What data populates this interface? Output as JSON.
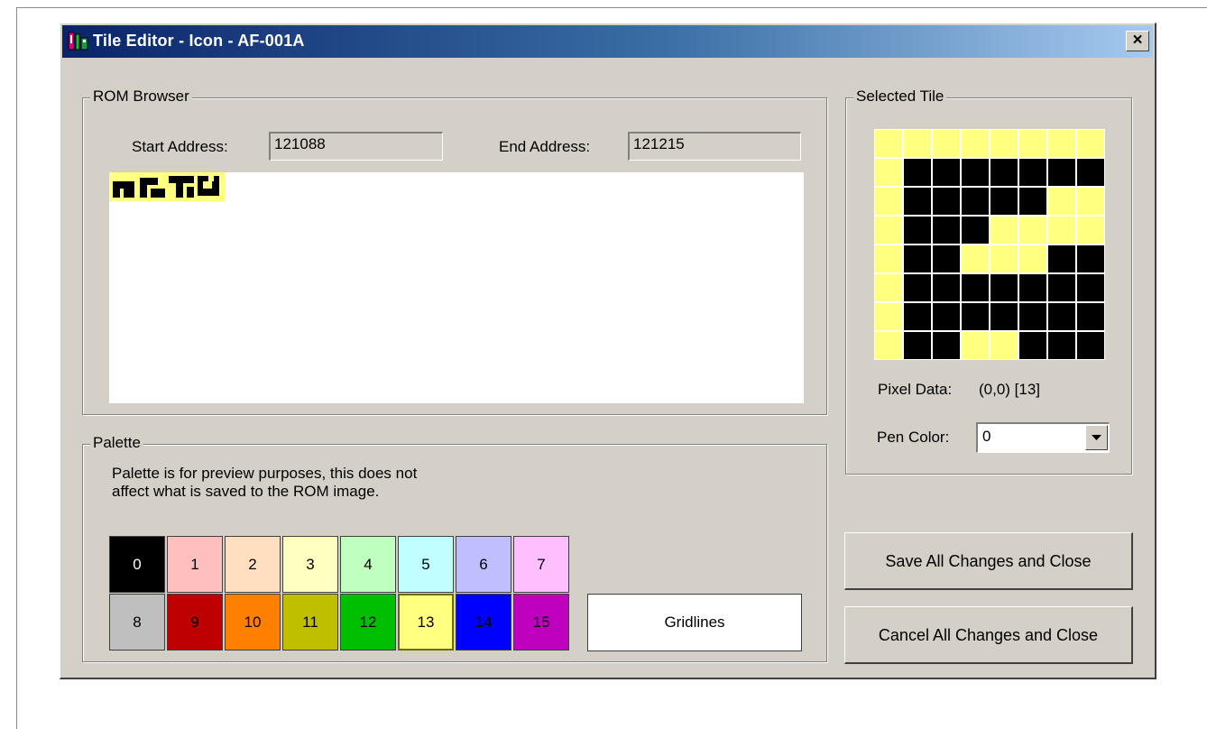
{
  "window": {
    "title": "Tile Editor - Icon - AF-001A",
    "close_label": "×"
  },
  "rom_browser": {
    "legend": "ROM Browser",
    "start_label": "Start Address:",
    "start_value": "121088",
    "end_label": "End Address:",
    "end_value": "121215"
  },
  "palette": {
    "legend": "Palette",
    "note_line1": "Palette is for preview purposes, this does not",
    "note_line2": "affect what is saved to the ROM image.",
    "selected_index": 13,
    "colors": [
      {
        "label": "0",
        "bg": "#000000",
        "fg": "#ffffff"
      },
      {
        "label": "1",
        "bg": "#ffbfbf",
        "fg": "#000000"
      },
      {
        "label": "2",
        "bg": "#ffdfbf",
        "fg": "#000000"
      },
      {
        "label": "3",
        "bg": "#ffffbf",
        "fg": "#000000"
      },
      {
        "label": "4",
        "bg": "#bfffbf",
        "fg": "#000000"
      },
      {
        "label": "5",
        "bg": "#bfffff",
        "fg": "#000000"
      },
      {
        "label": "6",
        "bg": "#bfbfff",
        "fg": "#000000"
      },
      {
        "label": "7",
        "bg": "#ffbfff",
        "fg": "#000000"
      },
      {
        "label": "8",
        "bg": "#bfbfbf",
        "fg": "#000000"
      },
      {
        "label": "9",
        "bg": "#bf0000",
        "fg": "#000000"
      },
      {
        "label": "10",
        "bg": "#ff8000",
        "fg": "#000000"
      },
      {
        "label": "11",
        "bg": "#bfbf00",
        "fg": "#000000"
      },
      {
        "label": "12",
        "bg": "#00bf00",
        "fg": "#000000"
      },
      {
        "label": "13",
        "bg": "#ffff80",
        "fg": "#000000"
      },
      {
        "label": "14",
        "bg": "#0000ff",
        "fg": "#000000"
      },
      {
        "label": "15",
        "bg": "#bf00bf",
        "fg": "#000000"
      }
    ],
    "gridlines_label": "Gridlines"
  },
  "selected_tile": {
    "legend": "Selected Tile",
    "pixels": [
      [
        13,
        13,
        13,
        13,
        13,
        13,
        13,
        13
      ],
      [
        13,
        0,
        0,
        0,
        0,
        0,
        0,
        0
      ],
      [
        13,
        0,
        0,
        0,
        0,
        0,
        13,
        13
      ],
      [
        13,
        0,
        0,
        0,
        13,
        13,
        13,
        13
      ],
      [
        13,
        0,
        0,
        13,
        13,
        13,
        0,
        0
      ],
      [
        13,
        0,
        0,
        0,
        0,
        0,
        0,
        0
      ],
      [
        13,
        0,
        0,
        0,
        0,
        0,
        0,
        0
      ],
      [
        13,
        0,
        0,
        13,
        13,
        0,
        0,
        0
      ]
    ],
    "pixel_data_label": "Pixel Data:",
    "pixel_data_value": "(0,0) [13]",
    "pen_color_label": "Pen Color:",
    "pen_color_value": "0"
  },
  "actions": {
    "save_label": "Save All Changes and Close",
    "cancel_label": "Cancel All Changes and Close"
  }
}
